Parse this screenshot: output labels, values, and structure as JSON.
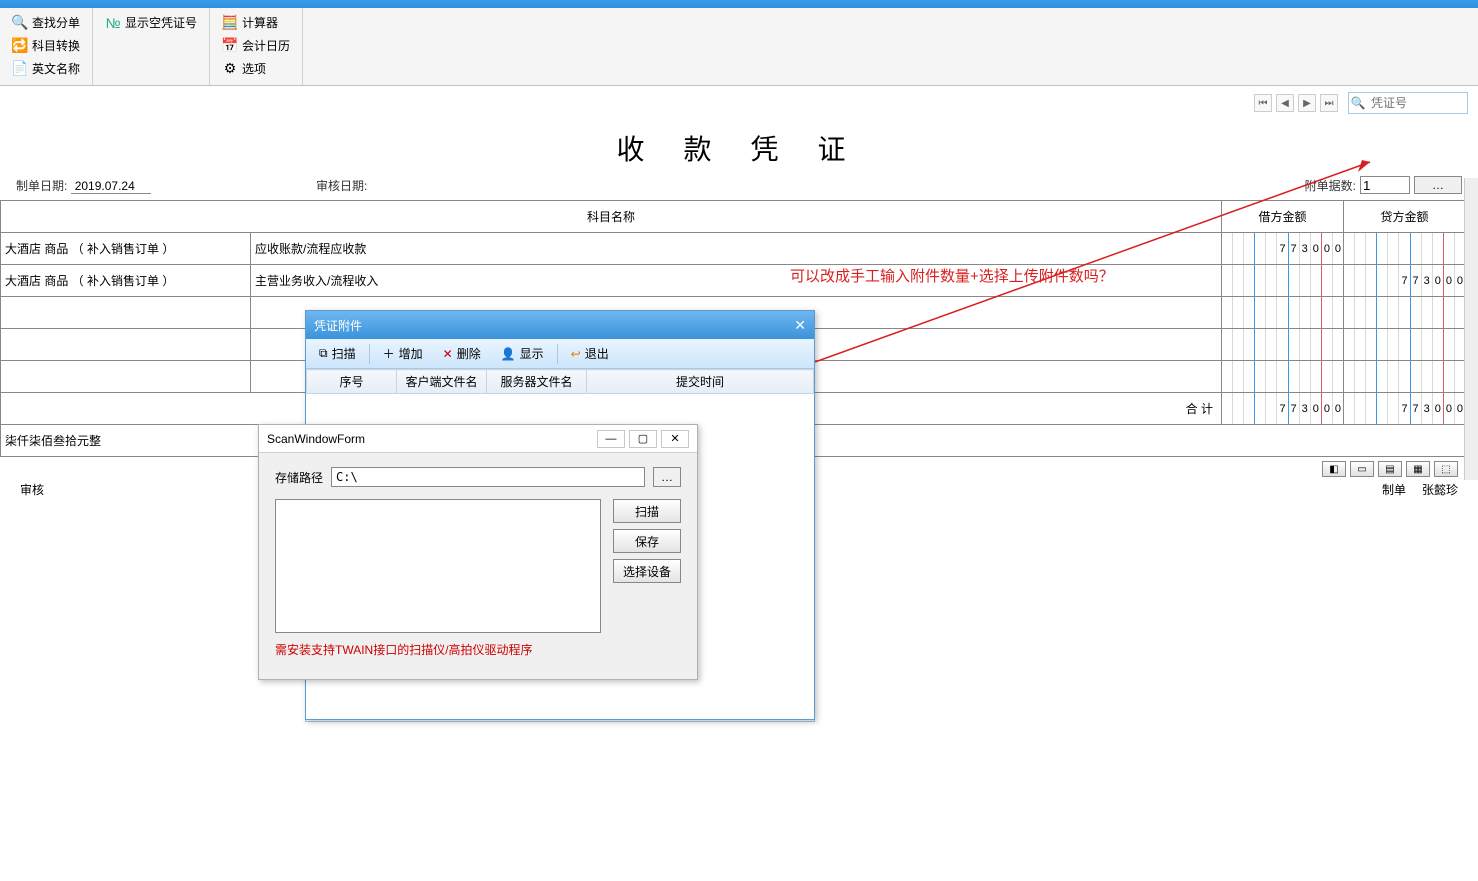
{
  "ribbon": {
    "group1": [
      {
        "label": "查找分单",
        "icon": "🔍"
      },
      {
        "label": "科目转换",
        "icon": "🔁"
      },
      {
        "label": "英文名称",
        "icon": "📄"
      }
    ],
    "group2": [
      {
        "label": "显示空凭证号",
        "icon": "№"
      }
    ],
    "group3": [
      {
        "label": "计算器",
        "icon": "🧮"
      },
      {
        "label": "会计日历",
        "icon": "📅"
      },
      {
        "label": "选项",
        "icon": "⚙"
      }
    ]
  },
  "nav": {
    "search_placeholder": "凭证号"
  },
  "voucher": {
    "title": "收 款 凭 证",
    "date_label": "制单日期:",
    "date_value": "2019.07.24",
    "audit_date_label": "审核日期:",
    "attach_label": "附单据数:",
    "attach_value": "1",
    "columns": {
      "subject": "科目名称",
      "debit": "借方金额",
      "credit": "贷方金额"
    },
    "rows": [
      {
        "summary": "大酒店 商品 （ 补入销售订单 ）",
        "subject": "应收账款/流程应收款",
        "debit": "773000",
        "credit": ""
      },
      {
        "summary": "大酒店 商品 （ 补入销售订单 ）",
        "subject": "主营业务收入/流程收入",
        "debit": "",
        "credit": "773000"
      },
      {
        "summary": "",
        "subject": "",
        "debit": "",
        "credit": ""
      },
      {
        "summary": "",
        "subject": "",
        "debit": "",
        "credit": ""
      },
      {
        "summary": "",
        "subject": "",
        "debit": "",
        "credit": ""
      }
    ],
    "total_label": "合 计",
    "total_debit": "773000",
    "total_credit": "773000",
    "cn_amount": "柒仟柒佰叁拾元整",
    "audit_label": "审核",
    "maker_label": "制单",
    "maker_name": "张懿珍"
  },
  "attach_dlg": {
    "title": "凭证附件",
    "tb": {
      "scan": "扫描",
      "add": "增加",
      "del": "删除",
      "show": "显示",
      "exit": "退出"
    },
    "cols": {
      "seq": "序号",
      "client": "客户端文件名",
      "server": "服务器文件名",
      "time": "提交时间"
    }
  },
  "scan_dlg": {
    "title": "ScanWindowForm",
    "path_label": "存储路径",
    "path_value": "C:\\",
    "btn_scan": "扫描",
    "btn_save": "保存",
    "btn_device": "选择设备",
    "hint": "需安装支持TWAIN接口的扫描仪/高拍仪驱动程序"
  },
  "annotation": "可以改成手工输入附件数量+选择上传附件数吗？",
  "bottom_badges": [
    "◧",
    "▭",
    "▤",
    "▦",
    "⬚"
  ]
}
